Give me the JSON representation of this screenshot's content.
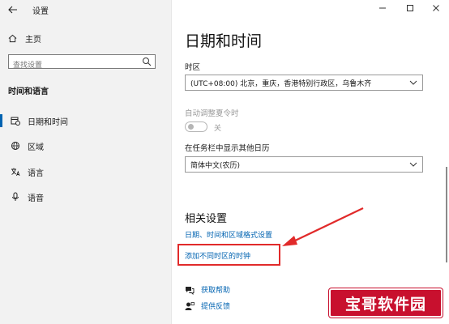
{
  "window": {
    "title": "设置",
    "controls": [
      "minimize-icon",
      "maximize-icon",
      "close-icon"
    ]
  },
  "sidebar": {
    "home_label": "主页",
    "search_placeholder": "查找设置",
    "section_title": "时间和语言",
    "items": [
      {
        "label": "日期和时间",
        "icon": "calendar-clock-icon",
        "active": true
      },
      {
        "label": "区域",
        "icon": "globe-icon",
        "active": false
      },
      {
        "label": "语言",
        "icon": "language-icon",
        "active": false
      },
      {
        "label": "语音",
        "icon": "microphone-icon",
        "active": false
      }
    ]
  },
  "main": {
    "page_title": "日期和时间",
    "timezone_label": "时区",
    "timezone_value": "(UTC+08:00) 北京，重庆，香港特别行政区，乌鲁木齐",
    "dst_label": "自动调整夏令时",
    "dst_toggle_state": "关",
    "calendar_label": "在任务栏中显示其他日历",
    "calendar_value": "简体中文(农历)",
    "related_title": "相关设置",
    "related_links": [
      "日期、时间和区域格式设置",
      "添加不同时区的时钟"
    ],
    "help": [
      {
        "label": "获取帮助",
        "icon": "help-chat-icon"
      },
      {
        "label": "提供反馈",
        "icon": "feedback-icon"
      }
    ]
  },
  "annotation": {
    "color": "#e12a2a"
  },
  "watermark": {
    "text": "宝哥软件园"
  },
  "colors": {
    "accent": "#0063b1",
    "sidebar_bg": "#f2f2f2"
  }
}
